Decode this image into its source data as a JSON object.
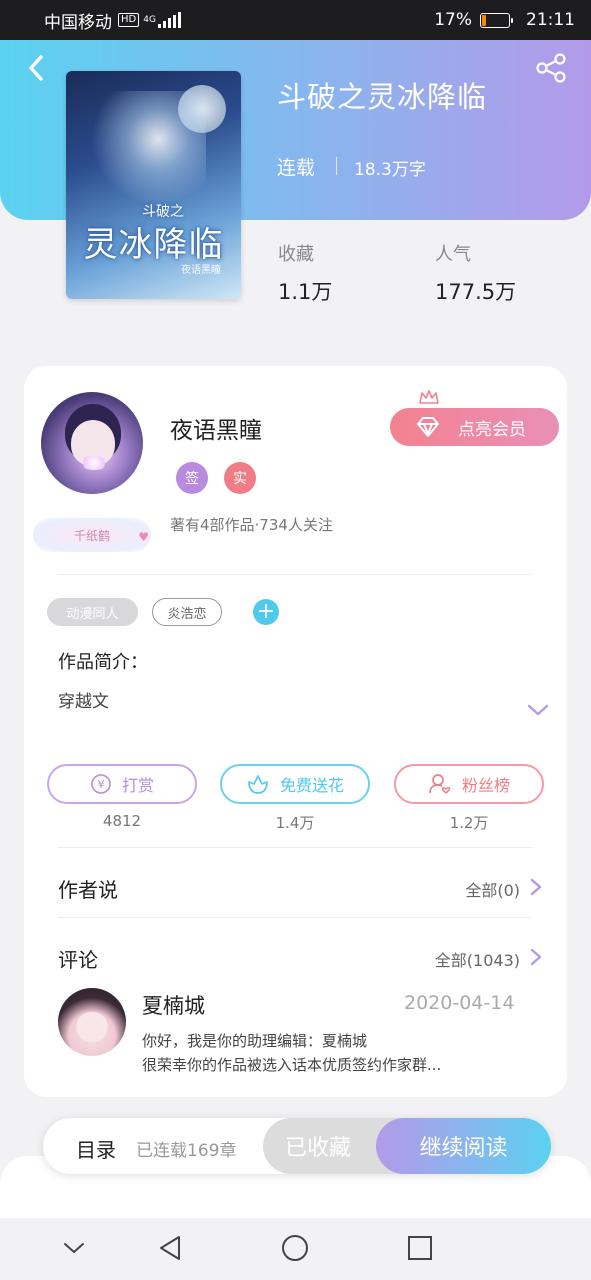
{
  "status_bar": {
    "carrier": "中国移动",
    "hd": "HD",
    "network": "4G",
    "battery": "17%",
    "battery_level": 0.17,
    "time": "21:11"
  },
  "book": {
    "title": "斗破之灵冰降临",
    "status": "连载",
    "word_count": "18.3万字",
    "cover": {
      "title": "灵冰降临",
      "subtitle": "斗破之",
      "author": "夜语黑瞳"
    },
    "stats": [
      {
        "label": "收藏",
        "value": "1.1万"
      },
      {
        "label": "人气",
        "value": "177.5万"
      }
    ]
  },
  "author": {
    "name": "夜语黑瞳",
    "vip_button": "点亮会员",
    "badge": "千纸鹤",
    "marks": [
      {
        "text": "签",
        "color": "#b98be0"
      },
      {
        "text": "实",
        "color": "#f07d86"
      }
    ],
    "works_info": "著有4部作品·734人关注"
  },
  "tags": [
    {
      "label": "动漫同人",
      "style": "filled"
    },
    {
      "label": "炎浩恋",
      "style": "outline"
    }
  ],
  "add_tag_label": "+",
  "intro": {
    "label": "作品简介：",
    "text": "穿越文"
  },
  "actions": [
    {
      "label": "打赏",
      "count": "4812",
      "color": "#b98be0",
      "icon": "yen-coin-icon",
      "glyph": "¥"
    },
    {
      "label": "免费送花",
      "count": "1.4万",
      "color": "#4fc9ec",
      "icon": "flower-icon"
    },
    {
      "label": "粉丝榜",
      "count": "1.2万",
      "color": "#f07d86",
      "icon": "fan-user-icon"
    }
  ],
  "author_says": {
    "title": "作者说",
    "link": "全部(0)"
  },
  "comments": {
    "title": "评论",
    "link": "全部(1043)",
    "items": [
      {
        "name": "夏楠城",
        "date": "2020-04-14",
        "lines": [
          "你好，我是你的助理编辑：夏楠城",
          "很荣幸你的作品被选入话本优质签约作家群..."
        ]
      }
    ]
  },
  "bottom_bar": {
    "toc": "目录",
    "chapters": "已连载169章",
    "favorited": "已收藏",
    "continue": "继续阅读"
  },
  "colors": {
    "accent_cyan": "#5ad2f0",
    "accent_purple": "#b39ae8",
    "accent_pink": "#f3828f"
  }
}
